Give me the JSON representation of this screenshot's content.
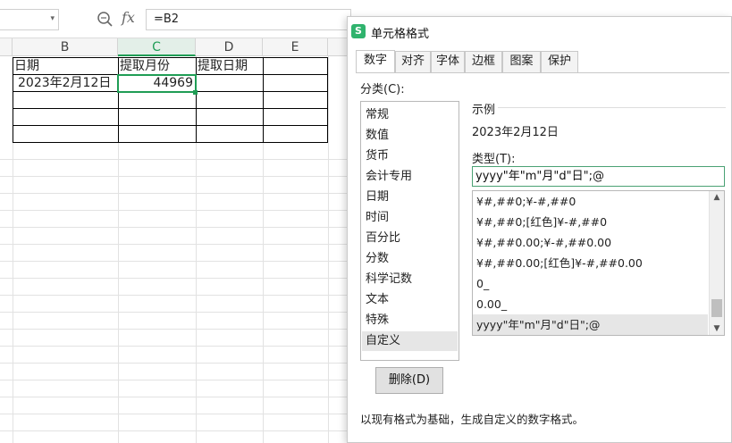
{
  "formula_bar": {
    "name_box_value": "",
    "formula_value": "=B2",
    "fx_label": "fx"
  },
  "sheet": {
    "columns": [
      "B",
      "C",
      "D",
      "E"
    ],
    "active_column": "C",
    "rows": [
      [
        "日期",
        "提取月份",
        "提取日期",
        ""
      ],
      [
        "2023年2月12日",
        "44969",
        "",
        ""
      ],
      [
        "",
        "",
        "",
        ""
      ],
      [
        "",
        "",
        "",
        ""
      ],
      [
        "",
        "",
        "",
        ""
      ]
    ]
  },
  "dialog": {
    "title": "单元格格式",
    "app_icon_letter": "S",
    "tabs": [
      {
        "label": "数字",
        "active": true
      },
      {
        "label": "对齐",
        "active": false
      },
      {
        "label": "字体",
        "active": false
      },
      {
        "label": "边框",
        "active": false
      },
      {
        "label": "图案",
        "active": false
      },
      {
        "label": "保护",
        "active": false
      }
    ],
    "category_label": "分类(C):",
    "categories": [
      {
        "label": "常规",
        "selected": false
      },
      {
        "label": "数值",
        "selected": false
      },
      {
        "label": "货币",
        "selected": false
      },
      {
        "label": "会计专用",
        "selected": false
      },
      {
        "label": "日期",
        "selected": false
      },
      {
        "label": "时间",
        "selected": false
      },
      {
        "label": "百分比",
        "selected": false
      },
      {
        "label": "分数",
        "selected": false
      },
      {
        "label": "科学记数",
        "selected": false
      },
      {
        "label": "文本",
        "selected": false
      },
      {
        "label": "特殊",
        "selected": false
      },
      {
        "label": "自定义",
        "selected": true
      }
    ],
    "sample_label": "示例",
    "sample_value": "2023年2月12日",
    "type_label": "类型(T):",
    "type_value": "yyyy\"年\"m\"月\"d\"日\";@",
    "formats": [
      {
        "label": "¥#,##0;¥-#,##0",
        "selected": false
      },
      {
        "label": "¥#,##0;[红色]¥-#,##0",
        "selected": false
      },
      {
        "label": "¥#,##0.00;¥-#,##0.00",
        "selected": false
      },
      {
        "label": "¥#,##0.00;[红色]¥-#,##0.00",
        "selected": false
      },
      {
        "label": "0_",
        "selected": false
      },
      {
        "label": "0.00_",
        "selected": false
      },
      {
        "label": "yyyy\"年\"m\"月\"d\"日\";@",
        "selected": true
      }
    ],
    "delete_label": "删除(D)",
    "hint": "以现有格式为基础，生成自定义的数字格式。"
  },
  "colors": {
    "accent": "#1f9d55",
    "selection_bg": "#e6e6e6"
  }
}
